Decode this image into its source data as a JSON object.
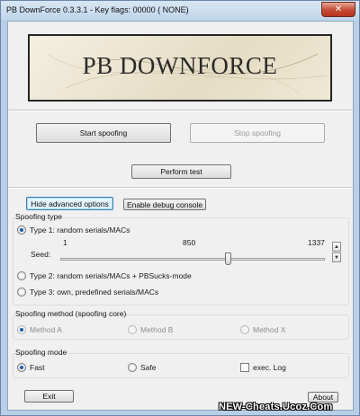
{
  "window": {
    "title": "PB DownForce 0.3.3.1  -  Key flags: 00000 ( NONE)",
    "close_glyph": "✕"
  },
  "banner": {
    "text": "PB DOWNFORCE"
  },
  "buttons": {
    "start": "Start spoofing",
    "stop": "Stop spoofing",
    "test": "Perform test",
    "hide_advanced": "Hide advanced options",
    "debug_console": "Enable debug console",
    "exit": "Exit",
    "about": "About"
  },
  "spoofing_type": {
    "label": "Spoofing type",
    "type1": "Type 1: random serials/MACs",
    "seed_label": "Seed:",
    "seed_min": "1",
    "seed_mid": "850",
    "seed_max": "1337",
    "seed_value": 850,
    "seed_range": [
      1,
      1337
    ],
    "type2": "Type 2: random serials/MACs + PBSucks-mode",
    "type3": "Type 3: own, predefined serials/MACs",
    "selected": "type1"
  },
  "spoofing_method": {
    "label": "Spoofing method (spoofing core)",
    "method_a": "Method A",
    "method_b": "Method B",
    "method_x": "Method X",
    "selected": "method_a"
  },
  "spoofing_mode": {
    "label": "Spoofing mode",
    "fast": "Fast",
    "safe": "Safe",
    "exec_log": "exec. Log",
    "selected": "fast",
    "exec_log_checked": false
  },
  "spin_up_glyph": "▲",
  "spin_down_glyph": "▼",
  "watermark": "NEW-Cheats.Ucoz.Com",
  "colors": {
    "frame": "#b8cfe6",
    "close_button": "#c44a33",
    "radio_dot": "#1a5db0",
    "focus_border": "#3c7fb1"
  }
}
